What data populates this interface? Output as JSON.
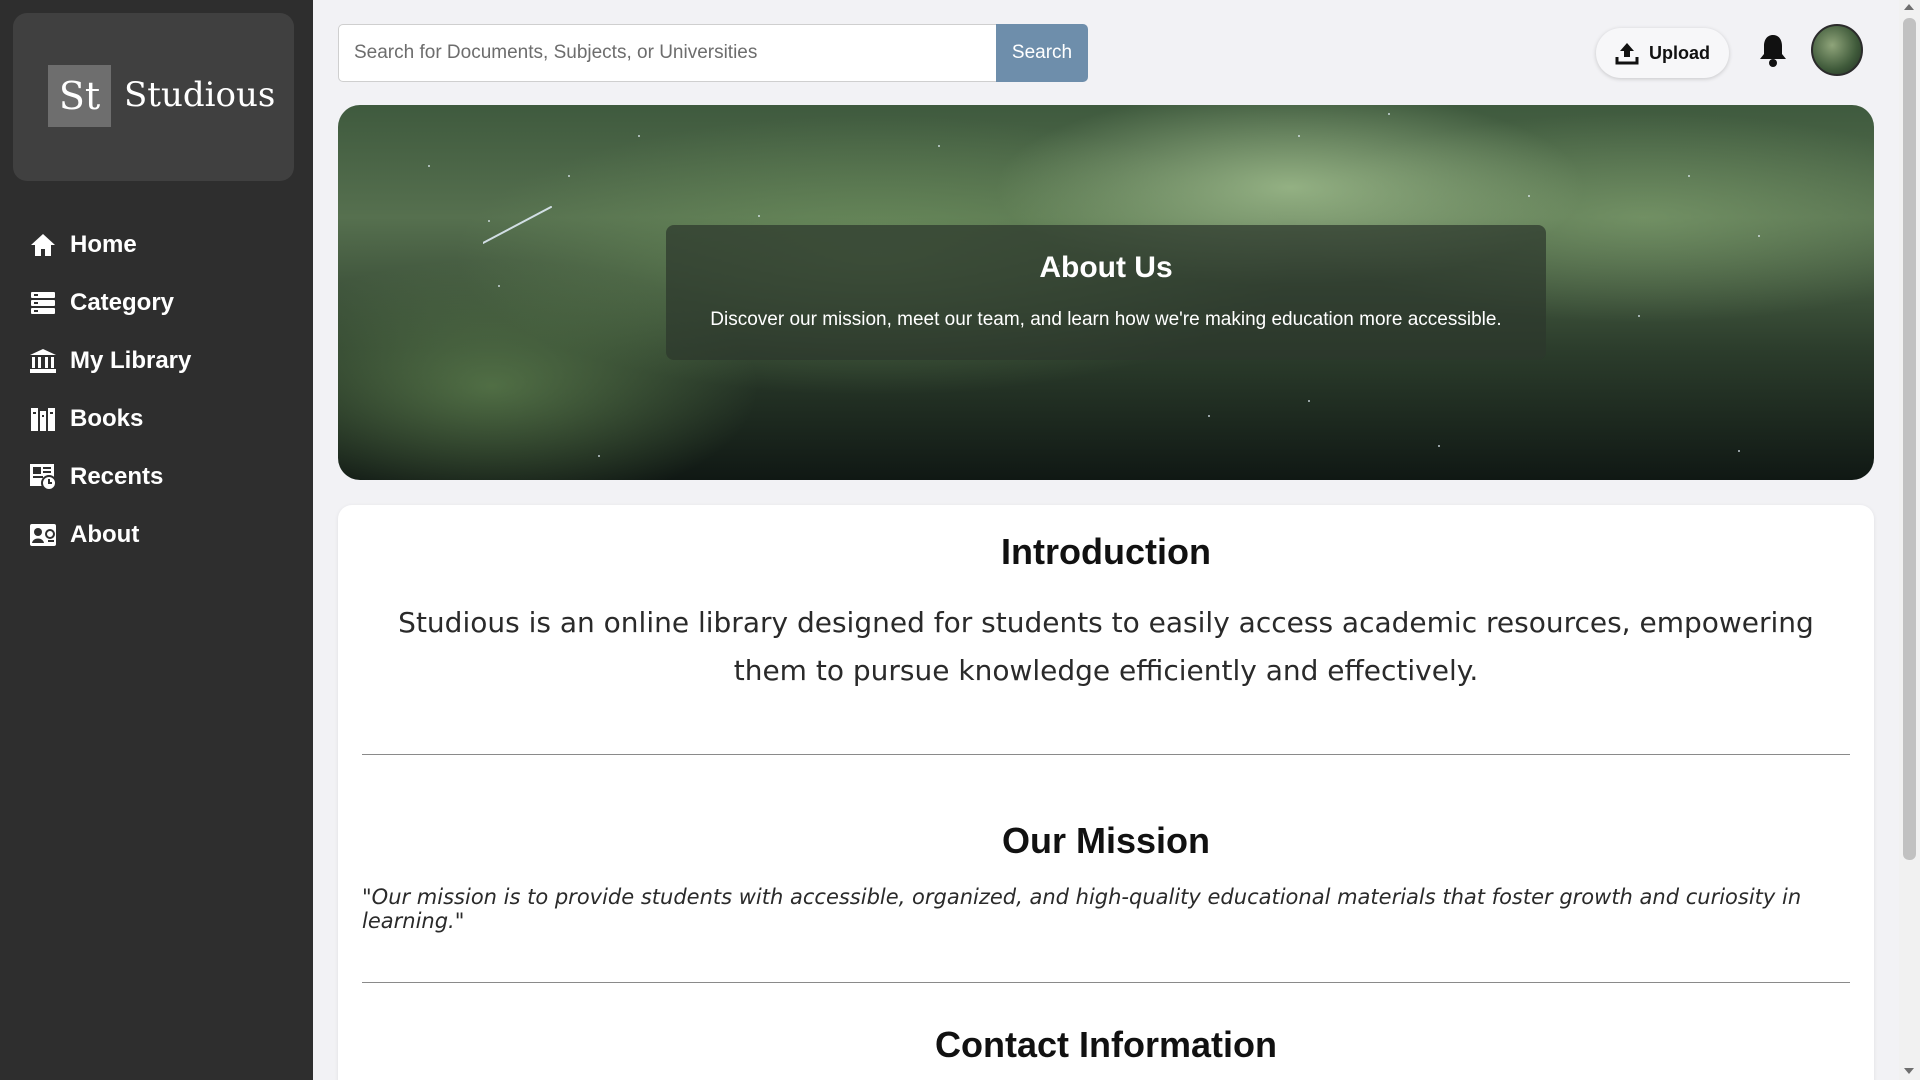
{
  "brand": {
    "mark": "St",
    "name": "Studious"
  },
  "sidebar": {
    "items": [
      {
        "label": "Home",
        "icon": "home-icon"
      },
      {
        "label": "Category",
        "icon": "category-icon"
      },
      {
        "label": "My Library",
        "icon": "library-icon"
      },
      {
        "label": "Books",
        "icon": "books-icon"
      },
      {
        "label": "Recents",
        "icon": "recents-icon"
      },
      {
        "label": "About",
        "icon": "about-icon"
      }
    ]
  },
  "header": {
    "search_placeholder": "Search for Documents, Subjects, or Universities",
    "search_value": "",
    "search_button": "Search",
    "upload_label": "Upload",
    "upload_icon": "upload-icon",
    "notification_icon": "bell-icon",
    "avatar_icon": "avatar"
  },
  "hero": {
    "title": "About Us",
    "subtitle": "Discover our mission, meet our team, and learn how we're making education more accessible."
  },
  "content": {
    "intro_heading": "Introduction",
    "intro_text": "Studious is an online library designed for students to easily access academic resources, empowering them to pursue knowledge efficiently and effectively.",
    "mission_heading": "Our Mission",
    "mission_text": "\"Our mission is to provide students with accessible, organized, and high-quality educational materials that foster growth and curiosity in learning.\"",
    "contact_heading": "Contact Information"
  },
  "colors": {
    "sidebar_bg": "#2e2e2e",
    "brand_bg": "#404040",
    "search_button_bg": "#6e8eab",
    "page_bg": "#f2f2f5"
  }
}
